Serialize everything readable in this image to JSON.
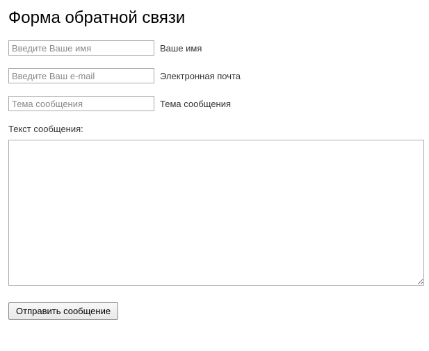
{
  "heading": "Форма обратной связи",
  "fields": {
    "name": {
      "placeholder": "Введите Ваше имя",
      "label": "Ваше имя"
    },
    "email": {
      "placeholder": "Введите Ваш e-mail",
      "label": "Электронная почта"
    },
    "subject": {
      "placeholder": "Тема сообщения",
      "label": "Тема сообщения"
    },
    "message": {
      "label": "Текст сообщения:"
    }
  },
  "submit_label": "Отправить сообщение"
}
